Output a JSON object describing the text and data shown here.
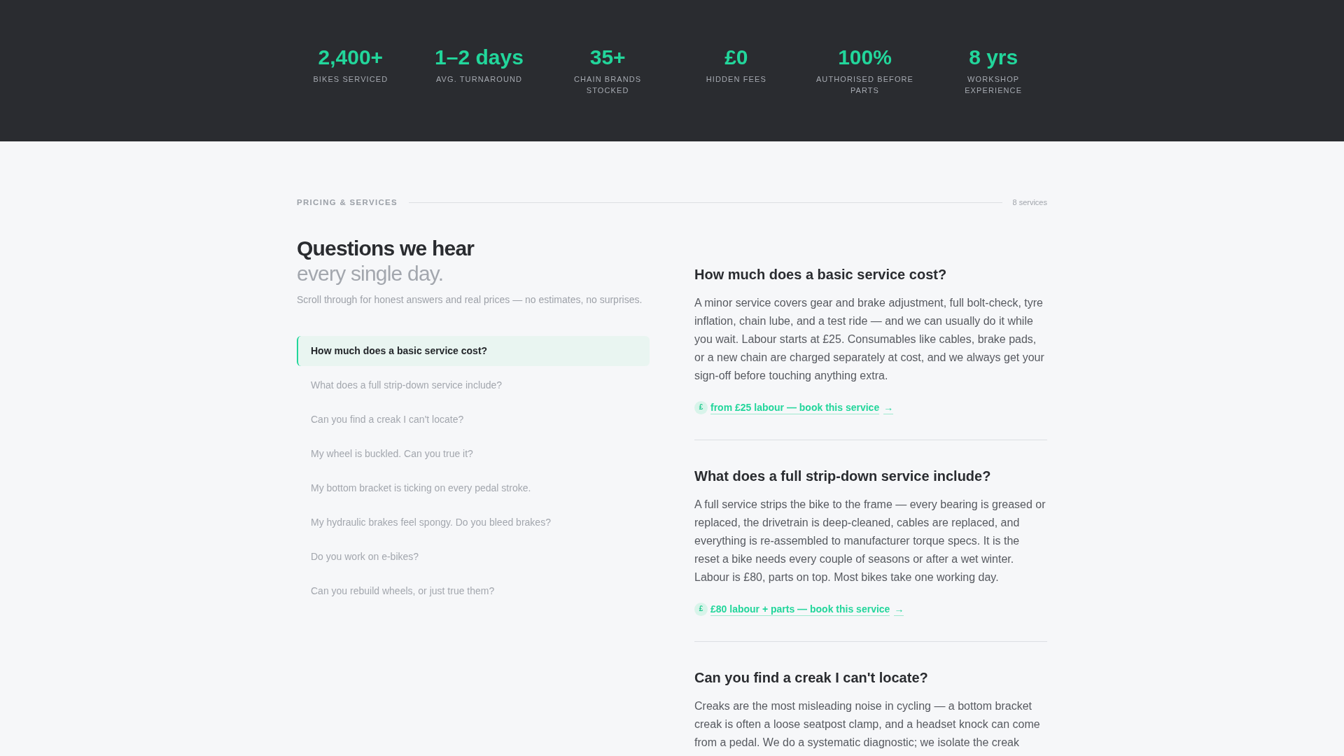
{
  "stats": [
    {
      "value": "2,400+",
      "label": "BIKES SERVICED"
    },
    {
      "value": "1–2 days",
      "label": "AVG. TURNAROUND"
    },
    {
      "value": "35+",
      "label": "CHAIN BRANDS STOCKED"
    },
    {
      "value": "£0",
      "label": "HIDDEN FEES"
    },
    {
      "value": "100%",
      "label": "AUTHORISED BEFORE PARTS"
    },
    {
      "value": "8 yrs",
      "label": "WORKSHOP EXPERIENCE"
    }
  ],
  "section": {
    "eyebrow": "PRICING & SERVICES",
    "count": "8 services"
  },
  "intro": {
    "title": "Questions we hear",
    "subtitle": "every single day.",
    "description": "Scroll through for honest answers and real prices — no estimates, no surprises."
  },
  "questions": [
    {
      "label": "How much does a basic service cost?",
      "selected": true
    },
    {
      "label": "What does a full strip-down service include?",
      "selected": false
    },
    {
      "label": "Can you find a creak I can't locate?",
      "selected": false
    },
    {
      "label": "My wheel is buckled. Can you true it?",
      "selected": false
    },
    {
      "label": "My bottom bracket is ticking on every pedal stroke.",
      "selected": false
    },
    {
      "label": "My hydraulic brakes feel spongy. Do you bleed brakes?",
      "selected": false
    },
    {
      "label": "Do you work on e-bikes?",
      "selected": false
    },
    {
      "label": "Can you rebuild wheels, or just true them?",
      "selected": false
    }
  ],
  "answers": [
    {
      "question": "How much does a basic service cost?",
      "answer": "A minor service covers gear and brake adjustment, full bolt-check, tyre inflation, chain lube, and a test ride — and we can usually do it while you wait. Labour starts at £25. Consumables like cables, brake pads, or a new chain are charged separately at cost, and we always get your sign-off before touching anything extra.",
      "price_icon": "£",
      "link": "from £25 labour — book this service",
      "arrow": "→"
    },
    {
      "question": "What does a full strip-down service include?",
      "answer": "A full service strips the bike to the frame — every bearing is greased or replaced, the drivetrain is deep-cleaned, cables are replaced, and everything is re-assembled to manufacturer torque specs. It is the reset a bike needs every couple of seasons or after a wet winter. Labour is £80, parts on top. Most bikes take one working day.",
      "price_icon": "£",
      "link": "£80 labour + parts — book this service",
      "arrow": "→"
    },
    {
      "question": "Can you find a creak I can't locate?",
      "answer": "Creaks are the most misleading noise in cycling — a bottom bracket creak is often a loose seatpost clamp, and a headset knock can come from a pedal. We do a systematic diagnostic; we isolate the creak"
    }
  ]
}
